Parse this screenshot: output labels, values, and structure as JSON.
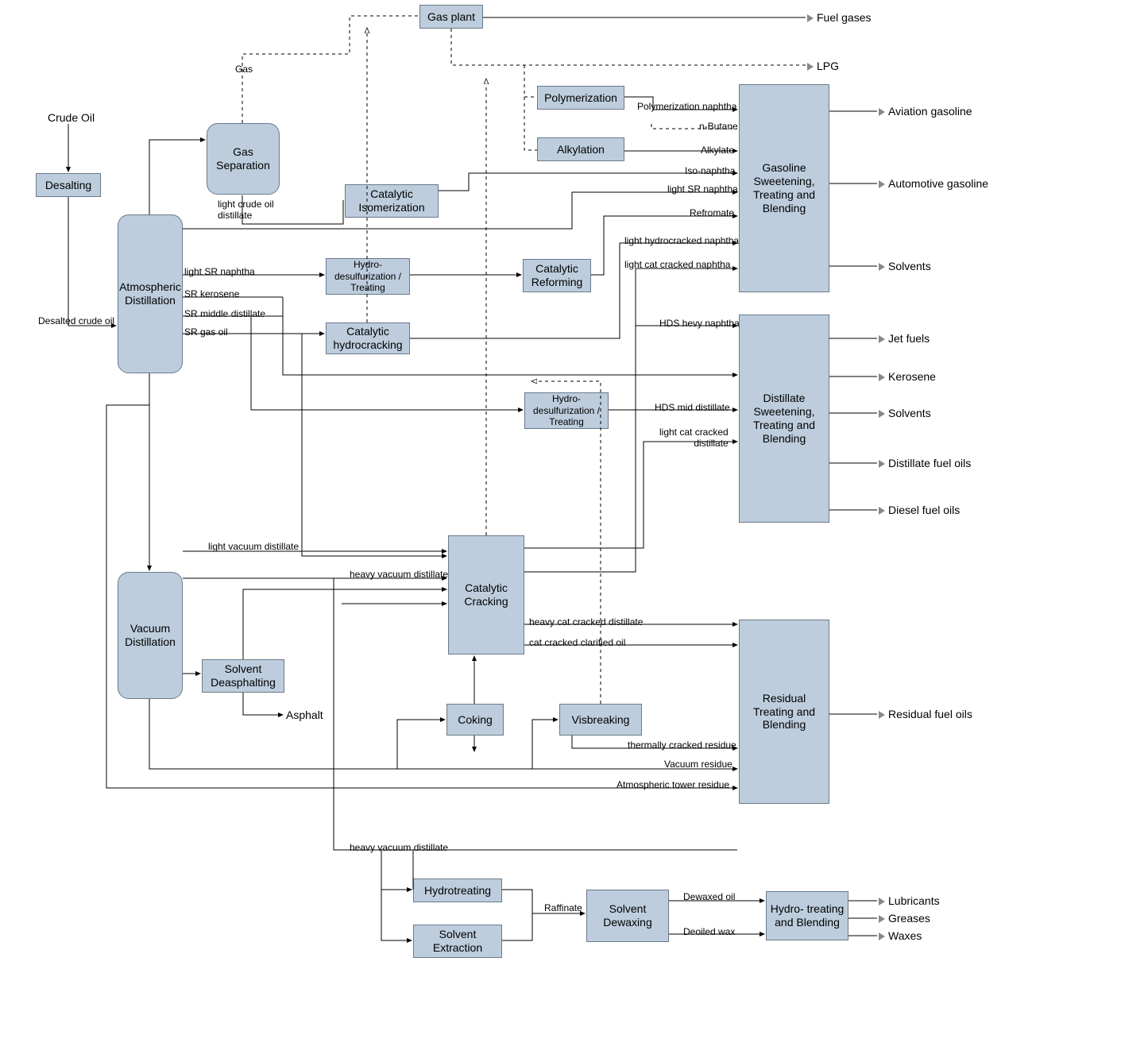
{
  "input": {
    "label": "Crude Oil"
  },
  "units": {
    "desalting": "Desalting",
    "gas_plant": "Gas plant",
    "gas_separation": "Gas\nSeparation",
    "catalytic_isomerization": "Catalytic\nIsomerization",
    "polymerization": "Polymerization",
    "alkylation": "Alkylation",
    "gasoline_blending": "Gasoline\nSweetening,\nTreating and\nBlending",
    "atmospheric_distillation": "Atmospheric\nDistillation",
    "hydrodesulf_treating_1": "Hydro-\ndesulfurization /\nTreating",
    "catalytic_reforming": "Catalytic\nReforming",
    "catalytic_hydrocracking": "Catalytic\nhydrocracking",
    "hydrodesulf_treating_2": "Hydro-\ndesulfurization /\nTreating",
    "distillate_blending": "Distillate\nSweetening,\nTreating and\nBlending",
    "vacuum_distillation": "Vacuum\nDistillation",
    "solvent_deasphalting": "Solvent\nDeasphalting",
    "catalytic_cracking": "Catalytic\nCracking",
    "coking": "Coking",
    "visbreaking": "Visbreaking",
    "residual_blending": "Residual\nTreating and\nBlending",
    "hydrotreating": "Hydrotreating",
    "solvent_extraction": "Solvent\nExtraction",
    "solvent_dewaxing": "Solvent\nDewaxing",
    "hydrotreating_blending": "Hydro-\ntreating and\nBlending"
  },
  "streams": {
    "desalted_crude_oil": "Desalted crude oil",
    "gas": "Gas",
    "light_crude_distillate": "light crude oil\ndistillate",
    "polymerization_naphtha": "Polymerization naphtha",
    "n_butane": "n-Butane",
    "alkylate": "Alkylate",
    "iso_naphtha": "Iso-naphtha",
    "light_sr_naphtha_top": "light SR naphtha",
    "refromate": "Refromate",
    "light_hydrocracked_naphtha": "light hydrocracked naphtha",
    "light_cat_cracked_naphtha": "light cat cracked naphtha",
    "light_sr_naphtha": "light SR naphtha",
    "sr_kerosene": "SR kerosene",
    "sr_middle_distillate": "SR middle distillate",
    "sr_gas_oil": "SR gas oil",
    "hds_heavy_naphtha": "HDS hevy naphtha",
    "hds_mid_distillate": "HDS mid distillate",
    "light_cat_cracked_distillate": "light cat cracked\ndistillate",
    "light_vacuum_distillate": "light vacuum distillate",
    "heavy_vacuum_distillate": "heavy vacuum distillate",
    "heavy_cat_cracked_distillate": "heavy cat cracked distillate",
    "cat_cracked_clarified_oil": "cat cracked clarified oil",
    "thermally_cracked_residue": "thermally cracked residue",
    "vacuum_residue": "Vacuum residue",
    "atmospheric_tower_residue": "Atmospheric tower residue",
    "heavy_vacuum_distillate_2": "heavy vacuum distillate",
    "asphalt": "Asphalt",
    "raffinate": "Raffinate",
    "dewaxed_oil": "Dewaxed oil",
    "deoiled_wax": "Deoiled wax"
  },
  "outputs": {
    "fuel_gases": "Fuel gases",
    "lpg": "LPG",
    "aviation_gasoline": "Aviation gasoline",
    "automotive_gasoline": "Automotive gasoline",
    "solvents_1": "Solvents",
    "jet_fuels": "Jet fuels",
    "kerosene": "Kerosene",
    "solvents_2": "Solvents",
    "distillate_fuel_oils": "Distillate fuel oils",
    "diesel_fuel_oils": "Diesel fuel oils",
    "residual_fuel_oils": "Residual fuel oils",
    "lubricants": "Lubricants",
    "greases": "Greases",
    "waxes": "Waxes"
  }
}
